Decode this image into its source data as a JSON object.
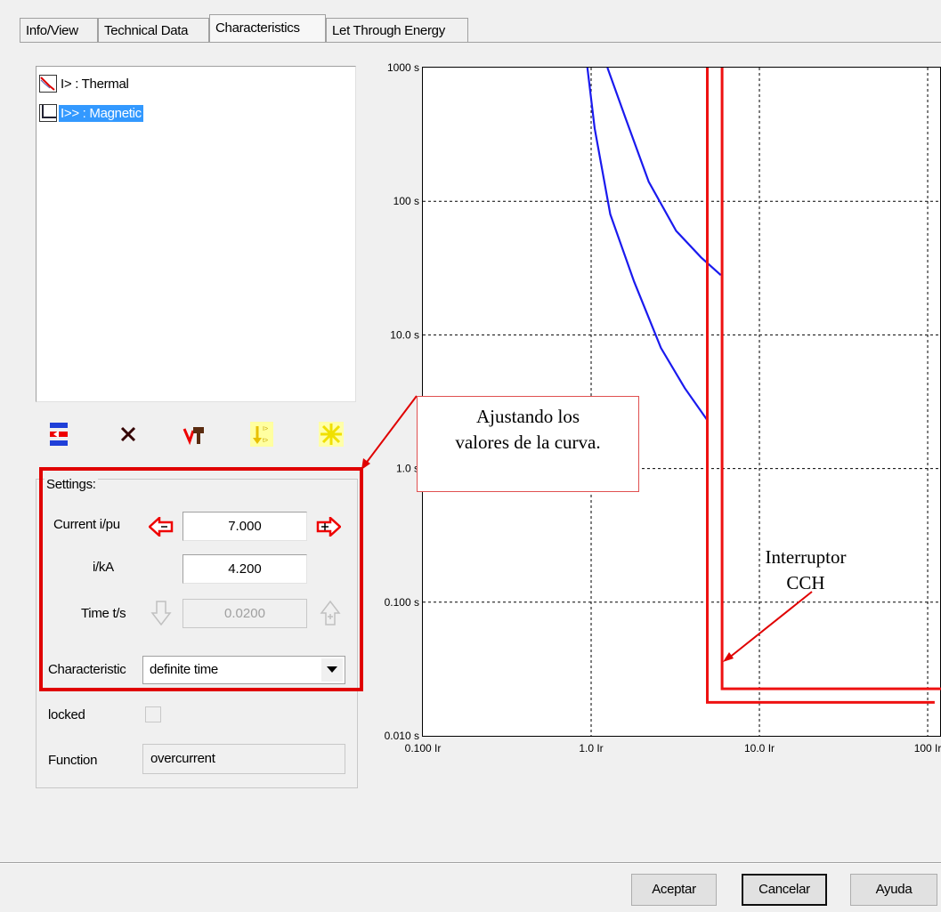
{
  "tabs": [
    {
      "label": "Info/View",
      "active": false
    },
    {
      "label": "Technical Data",
      "active": false
    },
    {
      "label": "Characteristics",
      "active": true
    },
    {
      "label": "Let Through Energy",
      "active": false
    }
  ],
  "tree": {
    "items": [
      {
        "label": "I> : Thermal",
        "icon": "thermal-curve-icon",
        "selected": false
      },
      {
        "label": "I>> : Magnetic",
        "icon": "magnetic-curve-icon",
        "selected": true
      }
    ]
  },
  "toolbar": {
    "icons": [
      "insert-stage-icon",
      "delete-icon",
      "hammer-icon",
      "tripping-icon",
      "new-icon"
    ]
  },
  "settings": {
    "group_label": "Settings:",
    "current_label": "Current i/pu",
    "current_value": "7.000",
    "ika_label": "i/kA",
    "ika_value": "4.200",
    "time_label": "Time t/s",
    "time_value": "0.0200",
    "characteristic_label": "Characteristic",
    "characteristic_value": "definite time",
    "locked_label": "locked",
    "locked_checked": false,
    "function_label": "Function",
    "function_value": "overcurrent"
  },
  "annotations": {
    "callout": [
      "Ajustando los",
      "valores de la curva."
    ],
    "breaker_label": [
      "Interruptor",
      "CCH"
    ]
  },
  "buttons": {
    "accept": "Aceptar",
    "cancel": "Cancelar",
    "help": "Ayuda"
  },
  "colors": {
    "breaker_curve": "#ee1111",
    "relay_curve": "#1a1aee",
    "annotation_red": "#e00000",
    "selection": "#3399ff"
  },
  "chart_data": {
    "type": "line",
    "x_scale": "log",
    "y_scale": "log",
    "xlim": [
      0.1,
      120
    ],
    "ylim": [
      0.01,
      1000
    ],
    "x_tick_labels": [
      "0.100 Ir",
      "1.0 Ir",
      "10.0 Ir",
      "100 Ir"
    ],
    "x_tick_values": [
      0.1,
      1,
      10,
      100
    ],
    "y_tick_labels": [
      "1000 s",
      "100 s",
      "10.0 s",
      "1.0 s",
      "0.100 s",
      "0.010 s"
    ],
    "y_tick_values": [
      1000,
      100,
      10,
      1,
      0.1,
      0.01
    ],
    "grid": true,
    "series": [
      {
        "color": "#1a1aee",
        "x": [
          0.95,
          1.05,
          1.3,
          1.8,
          2.6,
          3.6,
          4.9
        ],
        "y": [
          1000,
          350,
          80,
          25,
          8,
          4,
          2.3
        ]
      },
      {
        "color": "#1a1aee",
        "x": [
          1.25,
          1.6,
          2.2,
          3.2,
          4.5,
          5.9
        ],
        "y": [
          1000,
          420,
          140,
          60,
          38,
          28
        ]
      },
      {
        "color": "#ee1111",
        "x": [
          4.9,
          4.9,
          110
        ],
        "y": [
          1000,
          0.0178,
          0.0178
        ]
      },
      {
        "color": "#ee1111",
        "x": [
          6.0,
          6.0,
          120
        ],
        "y": [
          1000,
          0.0225,
          0.0225
        ]
      }
    ]
  }
}
